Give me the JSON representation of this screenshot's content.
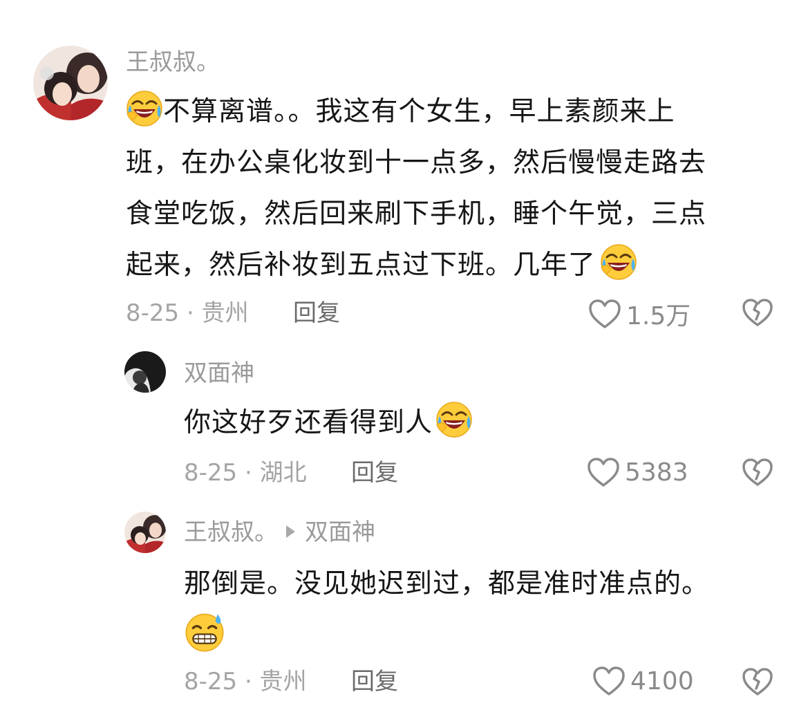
{
  "comments": [
    {
      "author": "王叔叔。",
      "text_lines": [
        "不算离谱。。我这有个女生，早上素颜来上",
        "班，在办公桌化妆到十一点多，然后慢慢走路去",
        "食堂吃饭，然后回来刷下手机，睡个午觉，三点",
        "起来，然后补妆到五点过下班。几年了"
      ],
      "date_location": "8-25 · 贵州",
      "reply_label": "回复",
      "likes": "1.5万"
    },
    {
      "author": "双面神",
      "text": "你这好歹还看得到人",
      "date_location": "8-25 · 湖北",
      "reply_label": "回复",
      "likes": "5383"
    },
    {
      "author": "王叔叔。",
      "reply_to": "双面神",
      "text": "那倒是。没见她迟到过，都是准时准点的。",
      "date_location": "8-25 · 贵州",
      "reply_label": "回复",
      "likes": "4100"
    }
  ],
  "icons": {
    "like": "heart-outline-icon",
    "dislike": "broken-heart-icon",
    "reply_arrow": "play-arrow-icon"
  },
  "colors": {
    "text": "#161616",
    "secondary": "#9a9a9a",
    "icon": "#8a8a8a"
  }
}
